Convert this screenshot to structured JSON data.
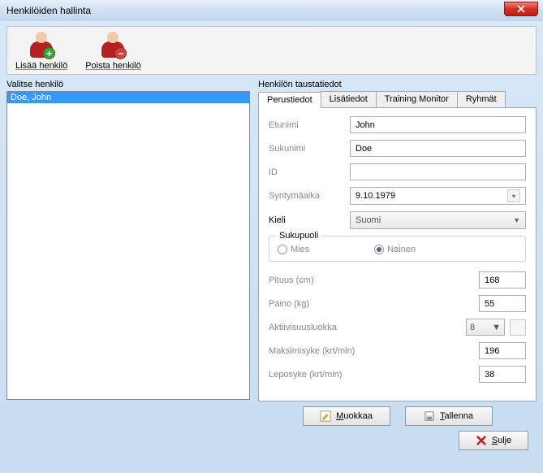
{
  "window": {
    "title": "Henkilöiden hallinta"
  },
  "toolbar": {
    "add_label": "Lisää henkilö",
    "remove_label": "Poista henkilö"
  },
  "left": {
    "section_label": "Valitse henkilö",
    "items": [
      "Doe, John"
    ],
    "selected_index": 0
  },
  "right": {
    "section_label": "Henkilön taustatiedot",
    "tabs": [
      "Perustiedot",
      "Lisätiedot",
      "Training Monitor",
      "Ryhmät"
    ],
    "active_tab": 0
  },
  "form": {
    "etunimi": {
      "label": "Etunimi",
      "value": "John"
    },
    "sukunimi": {
      "label": "Sukunimi",
      "value": "Doe"
    },
    "id": {
      "label": "ID",
      "value": ""
    },
    "syntymaaika": {
      "label": "Syntymäaika",
      "value": "9.10.1979"
    },
    "kieli": {
      "label": "Kieli",
      "value": "Suomi"
    },
    "sukupuoli": {
      "legend": "Sukupuoli",
      "options": [
        "Mies",
        "Nainen"
      ],
      "selected": 1
    },
    "pituus": {
      "label": "Pituus (cm)",
      "value": "168"
    },
    "paino": {
      "label": "Paino (kg)",
      "value": "55"
    },
    "aktiivisuus": {
      "label": "Aktiivisuusluokka",
      "value": "8"
    },
    "maksimisyke": {
      "label": "Maksimisyke (krt/min)",
      "value": "196"
    },
    "leposyke": {
      "label": "Leposyke (krt/min)",
      "value": "38"
    }
  },
  "buttons": {
    "edit": "Muokkaa",
    "save": "Tallenna",
    "close": "Sulje"
  }
}
